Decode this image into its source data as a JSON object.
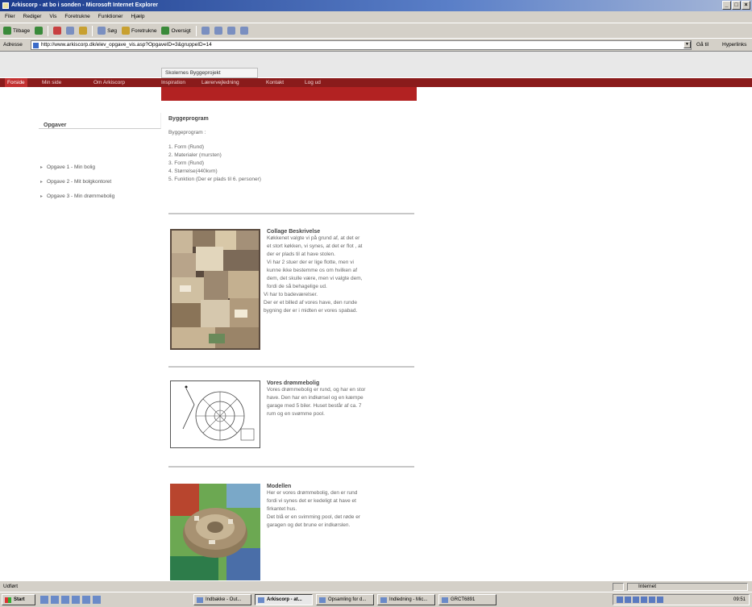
{
  "window": {
    "title": "Arkiscorp - at bo i sonden - Microsoft Internet Explorer"
  },
  "menu": [
    "Filer",
    "Rediger",
    "Vis",
    "Foretrukne",
    "Funktioner",
    "Hjælp"
  ],
  "toolbar": {
    "back": "Tilbage",
    "search": "Søg",
    "favorites": "Foretrukne",
    "history": "Oversigt"
  },
  "address": {
    "label": "Adresse",
    "url": "http://www.arkiscorp.dk/elev_opgave_vis.asp?OpgaveID=3&gruppeID=14",
    "go": "Gå til",
    "links": "Hyperlinks"
  },
  "page": {
    "label": "Skolernes Byggeprojekt",
    "nav": [
      {
        "label": "Forside",
        "active": true
      },
      {
        "label": "Min side",
        "active": false
      },
      {
        "label": "Om Arkiscorp",
        "active": false
      },
      {
        "label": "Inspiration",
        "active": false
      },
      {
        "label": "Lærervejledning",
        "active": false
      },
      {
        "label": "Kontakt",
        "active": false
      },
      {
        "label": "Log ud",
        "active": false
      }
    ],
    "sidebar": {
      "title": "Opgaver",
      "links": [
        "Opgave 1 - Min bolig",
        "Opgave 2 - Mit bolgkontoret",
        "Opgave 3 - Min drømmebolig"
      ]
    },
    "intro": {
      "heading": "Byggeprogram",
      "subheading": "Byggeprogram :",
      "items": [
        "1. Form (Rund)",
        "2. Materialer (mursten)",
        "3. Form (Rund)",
        "4. Størrelse(440kvm)",
        "5. Funktion (Der er plads til 6. personer)"
      ]
    },
    "articles": [
      {
        "title": "Collage Beskrivelse",
        "body": [
          "Køkkenet valgte vi på grund af, at det er",
          "et stort køkken, vi synes, at det er flot , at",
          "der er plads til at have stolen.",
          "Vi har 2 stuer der er lige flotte, men vi",
          "kunne ikke bestemme os om hvilken af",
          "dem, det skulle være, men vi valgte dem,",
          "fordi de så behagelige ud.",
          "Vi har to badeværelser.",
          "Der er et billed af vores have, den runde",
          "bygning der er i midten er vores spabad."
        ]
      },
      {
        "title": "Vores drømmebolig",
        "body": [
          "Vores drømmebolig er rund, og har en stor",
          "have. Den har en indkørsel og en kæmpe",
          "garage med 5 biler. Huset består af ca. 7",
          "rum og en svømme pool."
        ]
      },
      {
        "title": "Modellen",
        "body": [
          "Her er vores drømmebolig, den er rund",
          "fordi vi synes det er kedeligt at have et",
          "firkantet hus.",
          "Det blå er en svimming pool, det røde er",
          "garagen og det brune er indkørslen."
        ]
      }
    ]
  },
  "status": {
    "left": "Udført",
    "zone": "Internet"
  },
  "taskbar": {
    "start": "Start",
    "tasks": [
      "Indbakke - Out...",
      "Arkiscorp - at...",
      "Opsamling for d...",
      "Indledning - Mic...",
      "GRCT6891"
    ],
    "clock": "09:51"
  }
}
